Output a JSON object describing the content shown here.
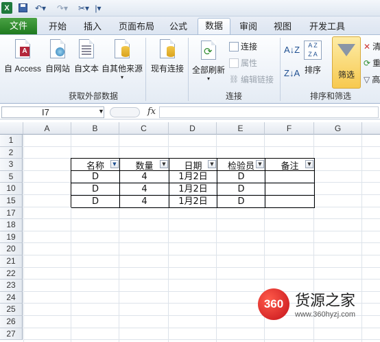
{
  "titlebar": {
    "undo_icon": "undo-icon",
    "redo_icon": "redo-icon"
  },
  "tabs": [
    "文件",
    "开始",
    "插入",
    "页面布局",
    "公式",
    "数据",
    "审阅",
    "视图",
    "开发工具"
  ],
  "active_tab": "数据",
  "ribbon": {
    "get_external": {
      "access": "自 Access",
      "web": "自网站",
      "text": "自文本",
      "other": "自其他来源",
      "group": "获取外部数据"
    },
    "existing": "现有连接",
    "connections": {
      "refresh_all": "全部刷新",
      "connect": "连接",
      "properties": "属性",
      "edit_links": "编辑链接",
      "group": "连接"
    },
    "sort": {
      "sort": "排序",
      "filter": "筛选",
      "clear": "清",
      "reapply": "重",
      "advanced": "高",
      "group": "排序和筛选"
    }
  },
  "formula_bar": {
    "name_box": "I7",
    "fx": "fx",
    "value": ""
  },
  "columns": [
    "A",
    "B",
    "C",
    "D",
    "E",
    "F",
    "G"
  ],
  "rows": [
    "1",
    "2",
    "3",
    "5",
    "10",
    "15",
    "17",
    "18",
    "19",
    "20",
    "21",
    "22",
    "23",
    "24",
    "25",
    "26",
    "27"
  ],
  "table": {
    "headers": [
      "名称",
      "数量",
      "日期",
      "检验员",
      "备注"
    ],
    "data": [
      [
        "D",
        "4",
        "1月2日",
        "D",
        ""
      ],
      [
        "D",
        "4",
        "1月2日",
        "D",
        ""
      ],
      [
        "D",
        "4",
        "1月2日",
        "D",
        ""
      ]
    ]
  },
  "watermark": {
    "logo": "360",
    "text": "货源之家",
    "url": "www.360hyzj.com"
  },
  "colors": {
    "file_tab": "#2e8b2e",
    "filter_active": "#f7d566",
    "selection": "#ffe8a3"
  }
}
